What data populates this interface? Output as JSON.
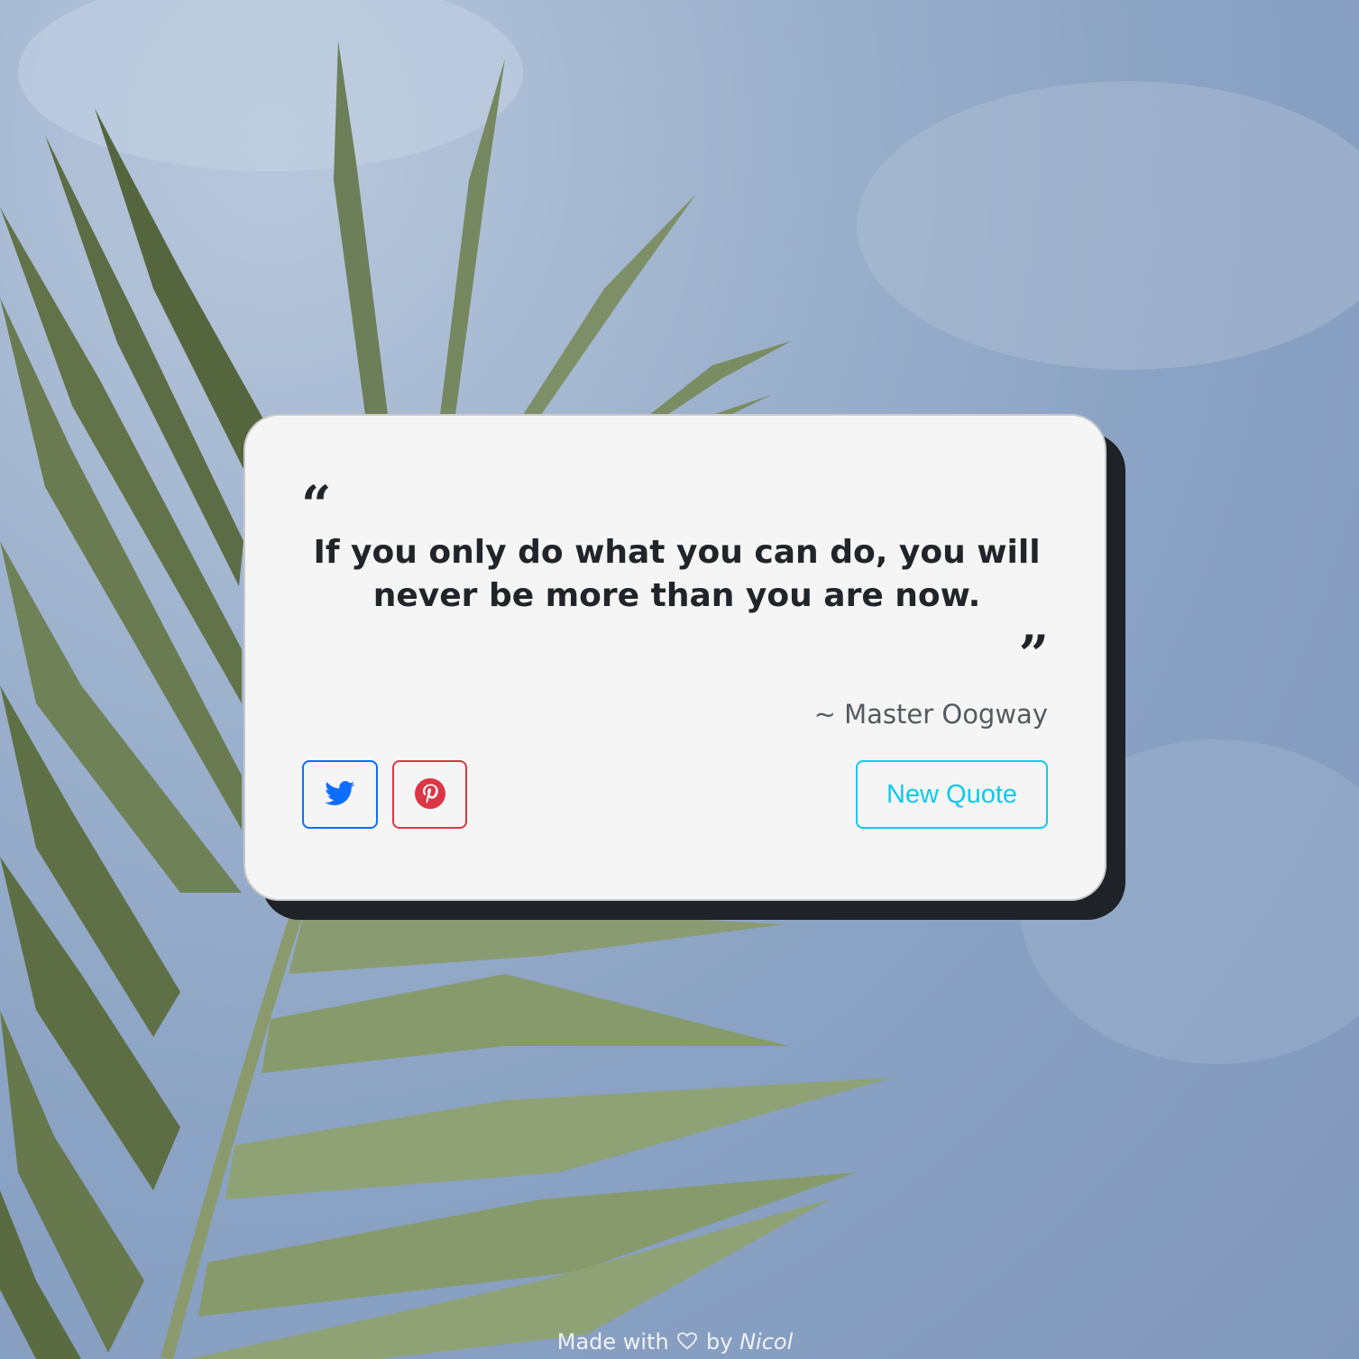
{
  "background": {
    "description_icon": "palm-leaf-sky-background",
    "sky_color": "#8aa2c3",
    "leaf_color": "#6f8159"
  },
  "card": {
    "quote_open_glyph": "“",
    "quote_text": "If you only do what you can do, you will never be more than you are now.",
    "quote_close_glyph": "”",
    "author": "~ Master Oogway",
    "buttons": {
      "twitter_icon": "twitter-icon",
      "pinterest_icon": "pinterest-icon",
      "new_quote_label": "New Quote"
    },
    "colors": {
      "twitter": "#0d6efd",
      "pinterest": "#dc3545",
      "new_quote": "#0dcaf0",
      "shadow": "#1f2227"
    }
  },
  "footer": {
    "made_with": "Made with",
    "heart_icon": "heart-outline-icon",
    "by": "by",
    "author_name": "Nicol"
  }
}
